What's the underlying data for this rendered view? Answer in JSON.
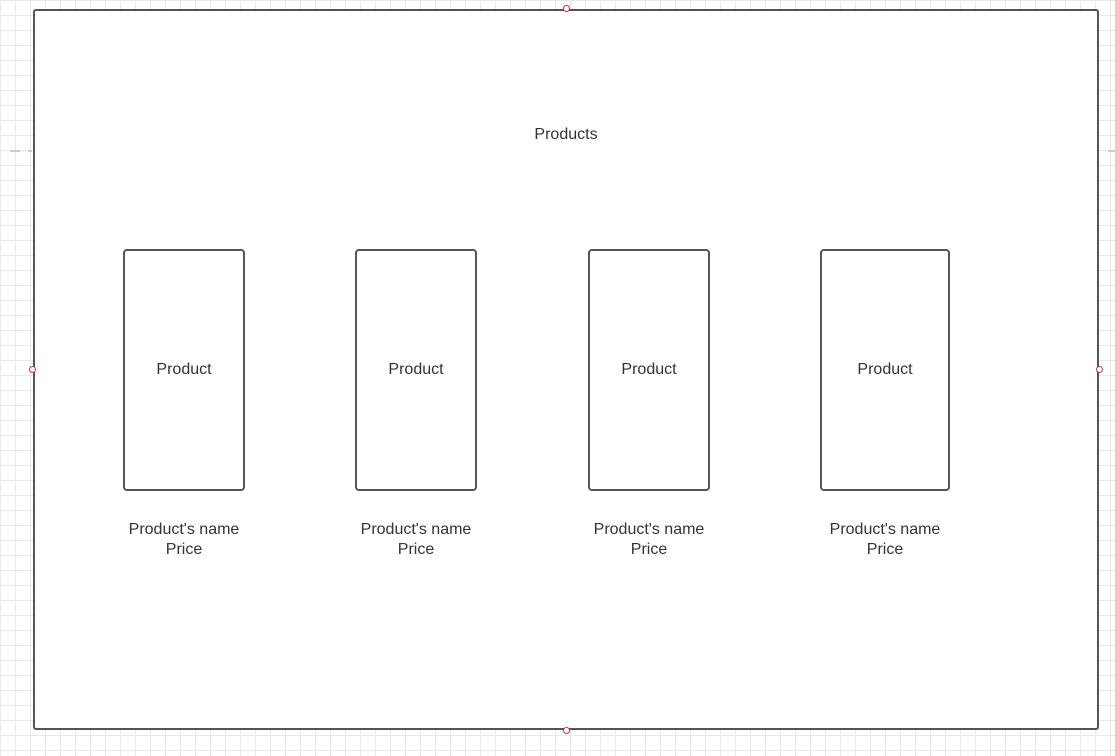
{
  "frame": {
    "title": "Products"
  },
  "products": [
    {
      "card_label": "Product",
      "name": "Product's name",
      "price": "Price"
    },
    {
      "card_label": "Product",
      "name": "Product's name",
      "price": "Price"
    },
    {
      "card_label": "Product",
      "name": "Product's name",
      "price": "Price"
    },
    {
      "card_label": "Product",
      "name": "Product's name",
      "price": "Price"
    }
  ],
  "colors": {
    "stroke": "#555555",
    "text": "#333333",
    "selection_handle": "#cc3344",
    "grid": "#e8e8e8"
  }
}
